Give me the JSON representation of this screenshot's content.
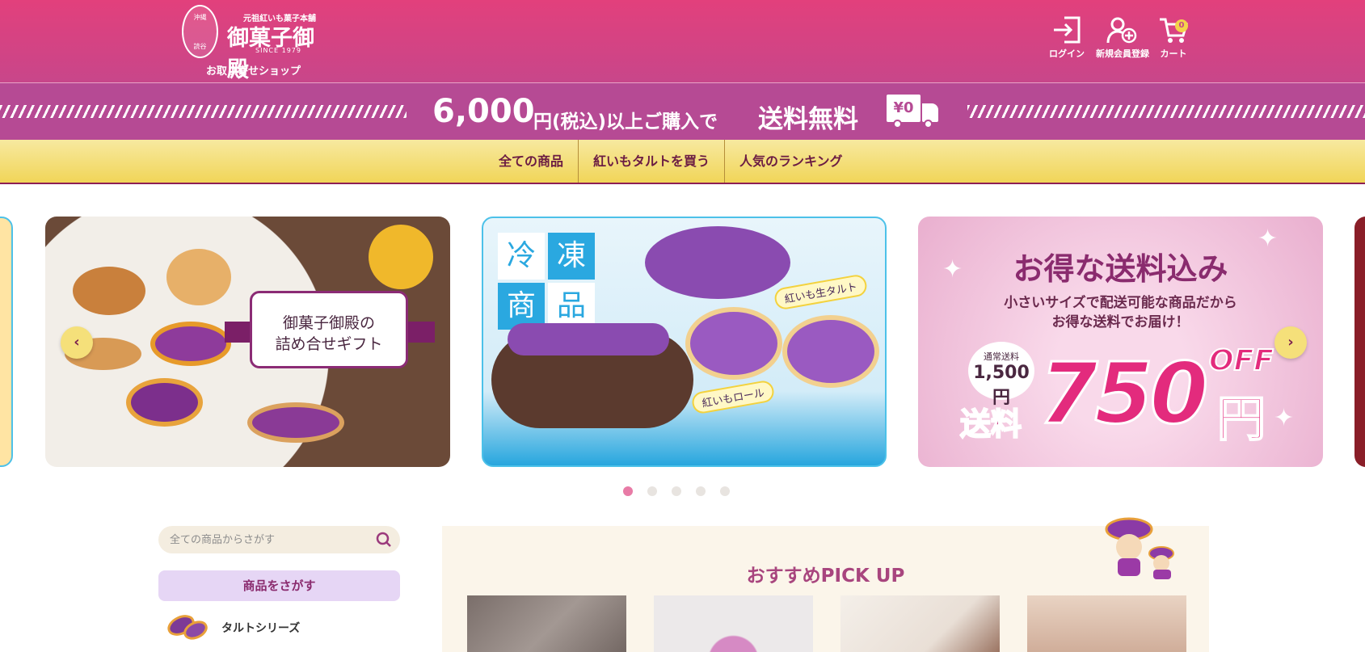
{
  "header": {
    "logo_small": "元祖紅いも菓子本舗",
    "logo_main": "御菓子御殿",
    "logo_since": "SINCE 1979",
    "logo_seal_top": "沖縄",
    "logo_seal_bottom": "読谷",
    "logo_sub": "お取り寄せショップ",
    "login_label": "ログイン",
    "register_label": "新規会員登録",
    "cart_label": "カート",
    "cart_count": "0"
  },
  "shipping": {
    "amount": "6,000",
    "text": "円(税込)以上ご購入で",
    "free": "送料無料",
    "truck_price": "¥0"
  },
  "nav": {
    "items": [
      "全ての商品",
      "紅いもタルトを買う",
      "人気のランキング"
    ]
  },
  "carousel": {
    "slide1": {
      "title_line1": "御菓子御殿の",
      "title_line2": "詰め合せギフト"
    },
    "slide2": {
      "tiles": [
        "冷",
        "凍",
        "商",
        "品"
      ],
      "tag1": "紅いも生タルト",
      "tag2": "紅いもロール"
    },
    "slide3": {
      "title": "お得な送料込み",
      "sub1": "小さいサイズで配送可能な商品だから",
      "sub2": "お得な送料でお届け！",
      "badge_label": "通常送料",
      "badge_price": "1,500円",
      "soryo": "送料",
      "big": "750",
      "off": "OFF",
      "yen": "円"
    },
    "prev_label": "‹",
    "next_label": "›",
    "dots_count": 5,
    "active_dot": 0
  },
  "sidebar": {
    "search_placeholder": "全ての商品からさがす",
    "find_label": "商品をさがす",
    "items": [
      {
        "label": "タルトシリーズ"
      }
    ]
  },
  "pickup": {
    "title": "おすすめPICK UP"
  },
  "colors": {
    "header_pink": "#e2407c",
    "banner_purple": "#b64a94",
    "nav_gold": "#f1d558",
    "accent_wine": "#8d1f54"
  }
}
